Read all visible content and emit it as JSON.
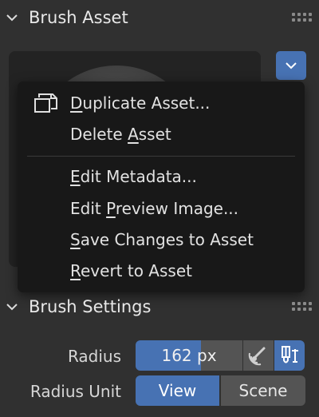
{
  "brush_asset_panel": {
    "title": "Brush Asset"
  },
  "context_menu": {
    "items": [
      {
        "pre": "",
        "ul": "D",
        "post": "uplicate Asset..."
      },
      {
        "pre": "Delete ",
        "ul": "A",
        "post": "sset"
      },
      {
        "pre": "",
        "ul": "E",
        "post": "dit Metadata..."
      },
      {
        "pre": "Edit ",
        "ul": "P",
        "post": "review Image..."
      },
      {
        "pre": "",
        "ul": "S",
        "post": "ave Changes to Asset"
      },
      {
        "pre": "",
        "ul": "R",
        "post": "evert to Asset"
      }
    ]
  },
  "brush_settings_panel": {
    "title": "Brush Settings",
    "radius": {
      "label": "Radius",
      "value": "162 px"
    },
    "radius_unit": {
      "label": "Radius Unit",
      "options": [
        "View",
        "Scene"
      ],
      "selected": "View"
    }
  },
  "colors": {
    "accent": "#4772b3",
    "background": "#303030",
    "menu_background": "#181818"
  },
  "icons": {
    "panel_toggle": "chevron-down-icon",
    "panel_grip": "drag-grip-icon",
    "dropdown": "chevron-down-icon",
    "duplicate": "duplicate-icon",
    "pressure": "pen-pressure-icon",
    "radius_lock": "scene-radius-icon"
  }
}
